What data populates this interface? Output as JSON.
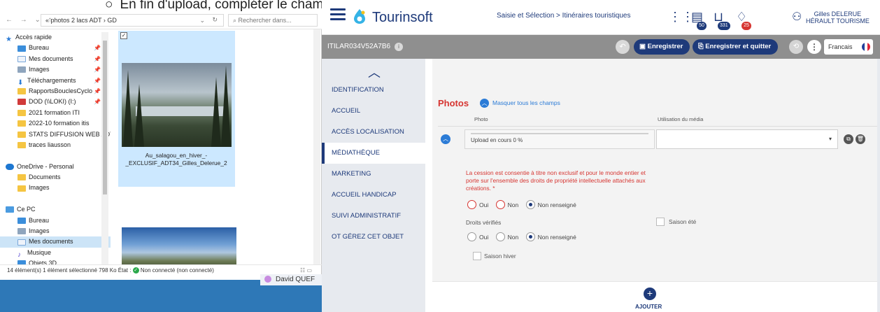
{
  "slide": {
    "bullet": "○",
    "text": "En fin d'upload, compléter le champ copyright et le volet concernant les droits d'utilisation"
  },
  "explorer": {
    "nav_glyphs": "← → ⌄ ↑",
    "path": "« photos 2 lacs ADT › GD",
    "path_dropdown": "⌄",
    "refresh": "↻",
    "search_placeholder": "⌕  Rechercher dans...",
    "tree": [
      {
        "label": "Accès rapide",
        "icon": "star-icon",
        "top": true,
        "pinned": false
      },
      {
        "label": "Bureau",
        "icon": "desktop-icon",
        "pinned": true
      },
      {
        "label": "Mes documents",
        "icon": "documents-icon",
        "pinned": true
      },
      {
        "label": "Images",
        "icon": "pictures-icon",
        "pinned": true
      },
      {
        "label": "Téléchargements",
        "icon": "download-icon",
        "pinned": true
      },
      {
        "label": "RapportsBouclesCyclo",
        "icon": "folder-icon",
        "pinned": true
      },
      {
        "label": "DOD (\\\\LOKI) (I:)",
        "icon": "network-drive-icon",
        "pinned": true
      },
      {
        "label": "2021 formation ITI",
        "icon": "folder-icon",
        "pinned": false
      },
      {
        "label": "2022-10 formation itis",
        "icon": "folder-icon",
        "pinned": false
      },
      {
        "label": "STATS DIFFUSION WEB ADT",
        "icon": "folder-icon",
        "pinned": false
      },
      {
        "label": "traces liausson",
        "icon": "folder-icon",
        "pinned": false
      },
      {
        "label": "",
        "icon": "",
        "pinned": false
      },
      {
        "label": "OneDrive - Personal",
        "icon": "cloud-icon",
        "top": true,
        "pinned": false
      },
      {
        "label": "Documents",
        "icon": "folder-icon",
        "pinned": false
      },
      {
        "label": "Images",
        "icon": "folder-icon",
        "pinned": false
      },
      {
        "label": "",
        "icon": "",
        "pinned": false
      },
      {
        "label": "Ce PC",
        "icon": "computer-icon",
        "top": true,
        "pinned": false
      },
      {
        "label": "Bureau",
        "icon": "desktop-icon",
        "pinned": false
      },
      {
        "label": "Images",
        "icon": "pictures-icon",
        "pinned": false
      },
      {
        "label": "Mes documents",
        "icon": "documents-icon",
        "pinned": false,
        "selected": true
      },
      {
        "label": "Musique",
        "icon": "music-icon",
        "pinned": false
      },
      {
        "label": "Objets 3D",
        "icon": "objects3d-icon",
        "pinned": false
      }
    ],
    "file_name": "Au_salagou_en_hiver_-_EXCLUSIF_ADT34_Gilles_Delerue_2",
    "checkbox_mark": "✓",
    "status": "14 élément(s)     1 élément sélectionné  798 Ko     État :",
    "status_connection": "Non connecté (non connecté)",
    "view_glyphs": "☷ ▭"
  },
  "taskbar": {
    "name": "David QUEF"
  },
  "app": {
    "logo": "Tourinsoft",
    "breadcrumb": "Saisie et Sélection > Itinéraires touristiques",
    "badges": [
      {
        "icon": "apps-grid-icon",
        "glyph": "⋮⋮",
        "count": ""
      },
      {
        "icon": "clipboard-icon",
        "glyph": "▤",
        "count": "50",
        "color": "#1e3a7a"
      },
      {
        "icon": "cart-icon",
        "glyph": "⊔",
        "count": "331",
        "color": "#1e3a7a"
      },
      {
        "icon": "bell-icon",
        "glyph": "♢",
        "count": "25",
        "color": "#d63531"
      }
    ],
    "user": {
      "name": "Gilles DELERUE",
      "org": "HÉRAULT TOURISME"
    },
    "object_id": "ITILAR034V52A7B6",
    "info": "i",
    "undo": "↶",
    "save_label": "Enregistrer",
    "save_quit_label": "Enregistrer et quitter",
    "history": "⟲",
    "more": "⋮",
    "language": "Francais",
    "colors": {
      "primary": "#1e3a7a",
      "accent": "#2b7bd6",
      "danger": "#d63531"
    }
  },
  "sidebar": {
    "collapse": "︿",
    "items": [
      {
        "label": "IDENTIFICATION",
        "active": false
      },
      {
        "label": "ACCUEIL",
        "active": false
      },
      {
        "label": "ACCÈS LOCALISATION",
        "active": false
      },
      {
        "label": "MÉDIATHÈQUE",
        "active": true
      },
      {
        "label": "MARKETING",
        "active": false
      },
      {
        "label": "ACCUEIL HANDICAP",
        "active": false
      },
      {
        "label": "SUIVI ADMINISTRATIF",
        "active": false
      },
      {
        "label": "OT GÉREZ CET OBJET",
        "active": false
      }
    ]
  },
  "photos": {
    "title": "Photos",
    "mask_link": "Masquer tous les champs",
    "col_photo": "Photo",
    "col_usage": "Utilisation du média",
    "upload_progress": 0,
    "upload_text": "Upload en cours 0 %",
    "usage_value": "",
    "cession_text": "La cession est consentie à titre non exclusif et pour le monde entier et porte sur l'ensemble des droits de propriété intellectuelle attachés aux créations. *",
    "options": [
      "Oui",
      "Non",
      "Non renseigné"
    ],
    "cession_selected": "Non renseigné",
    "droits_label": "Droits vérifiés",
    "droits_selected": "Non renseigné",
    "saison_ete": "Saison été",
    "saison_hiver": "Saison hiver",
    "add_label": "AJOUTER"
  }
}
